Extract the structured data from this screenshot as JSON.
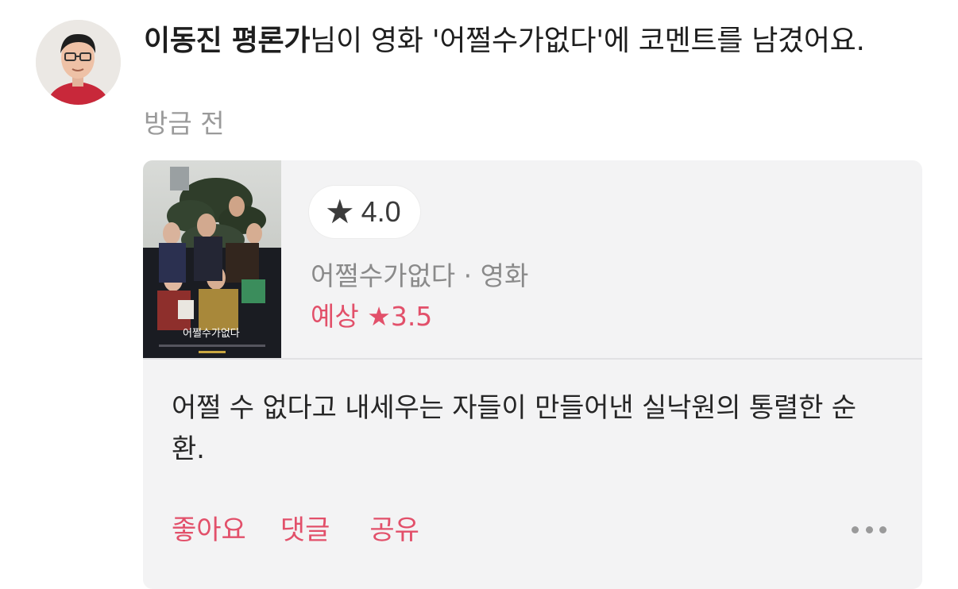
{
  "activity": {
    "user_name": "이동진 평론가",
    "message_rest": "님이 영화 '어쩔수가없다'에 코멘트를 남겼어요.",
    "time": "방금 전"
  },
  "card": {
    "poster_title_text": "어쩔수가없다",
    "my_rating": "4.0",
    "movie_meta": "어쩔수가없다 · 영화",
    "expected_label": "예상",
    "expected_rating": "★3.5",
    "comment_text": "어쩔 수 없다고 내세우는 자들이 만들어낸 실낙원의 통렬한 순환.",
    "actions": {
      "like": "좋아요",
      "comment": "댓글",
      "share": "공유"
    }
  },
  "icons": {
    "star": "star-icon",
    "more": "more-dots-icon"
  },
  "colors": {
    "accent": "#e2506a",
    "card_bg": "#f3f3f4",
    "muted_text": "#8a8a8a"
  }
}
